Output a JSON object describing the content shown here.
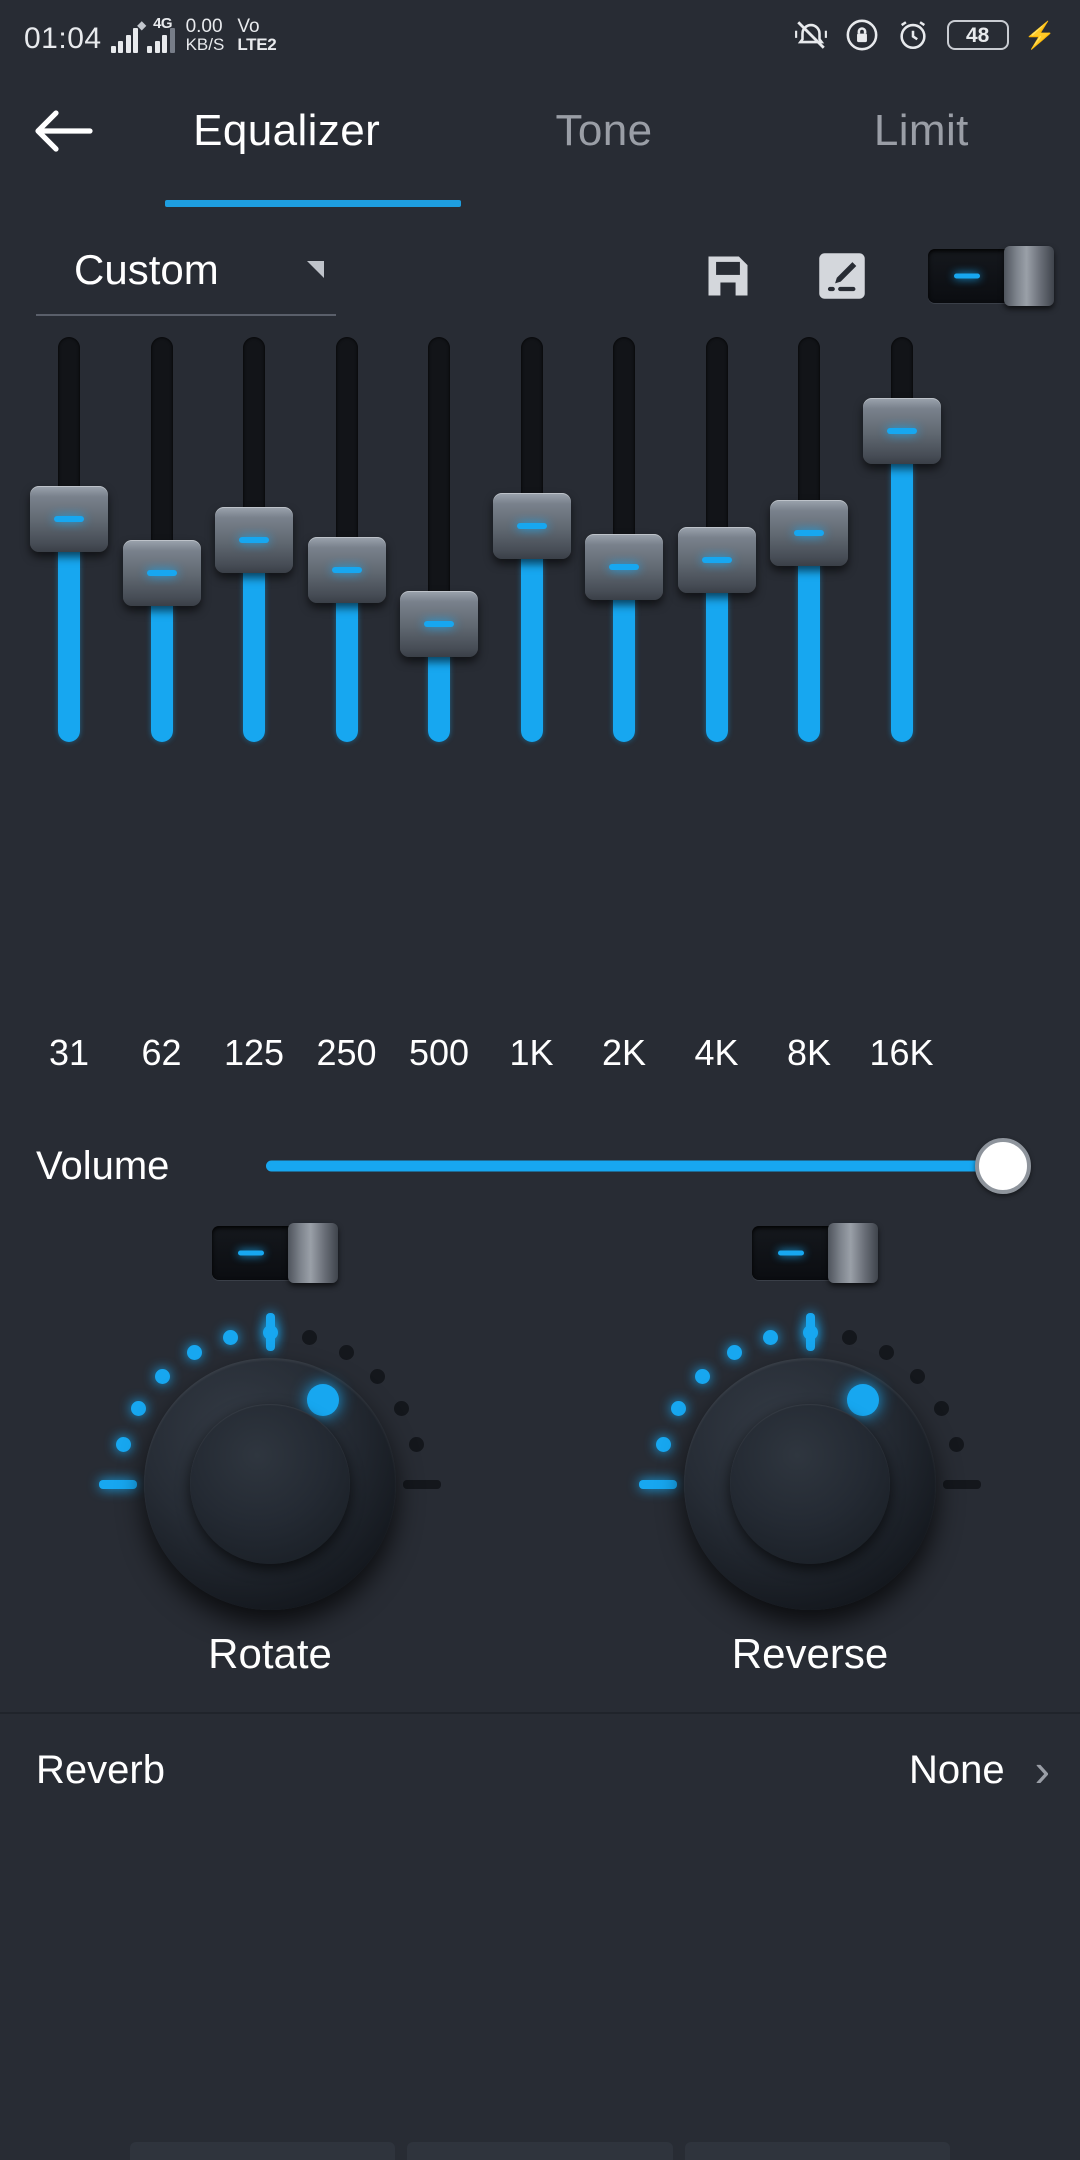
{
  "statusbar": {
    "time": "01:04",
    "network_type": "4G",
    "data_rate_value": "0.00",
    "data_rate_unit": "KB/S",
    "volte_top": "Vo",
    "volte_bottom": "LTE2",
    "battery_level": "48",
    "icons": [
      "signal-bars-icon",
      "4g-icon",
      "vibrate-off-icon",
      "rotation-lock-icon",
      "alarm-icon",
      "battery-icon",
      "charging-bolt-icon"
    ]
  },
  "header": {
    "back_label": "←",
    "tabs": [
      {
        "label": "Equalizer",
        "active": true
      },
      {
        "label": "Tone",
        "active": false
      },
      {
        "label": "Limit",
        "active": false
      }
    ]
  },
  "preset": {
    "selected": "Custom",
    "caret": "▾",
    "save_label": "save-icon",
    "edit_label": "edit-icon",
    "power_toggle_state": "on"
  },
  "equalizer": {
    "bands": [
      {
        "label": "31",
        "pct": 56
      },
      {
        "label": "62",
        "pct": 40
      },
      {
        "label": "125",
        "pct": 50
      },
      {
        "label": "250",
        "pct": 41
      },
      {
        "label": "500",
        "pct": 25
      },
      {
        "label": "1K",
        "pct": 54
      },
      {
        "label": "2K",
        "pct": 42
      },
      {
        "label": "4K",
        "pct": 44
      },
      {
        "label": "8K",
        "pct": 52
      },
      {
        "label": "16K",
        "pct": 82
      }
    ]
  },
  "volume": {
    "label": "Volume",
    "value_pct": 97
  },
  "knobs": [
    {
      "label": "Rotate",
      "toggle_state": "on",
      "lit_dots": 7
    },
    {
      "label": "Reverse",
      "toggle_state": "on",
      "lit_dots": 7
    }
  ],
  "reverb": {
    "label": "Reverb",
    "value": "None",
    "chevron": "›"
  },
  "colors": {
    "background": "#282c34",
    "accent": "#17a7f0",
    "tab_active_underline": "#1e9ee0",
    "text_primary": "#ffffff",
    "text_muted": "#9a9ea6",
    "track_dark": "#121418"
  }
}
